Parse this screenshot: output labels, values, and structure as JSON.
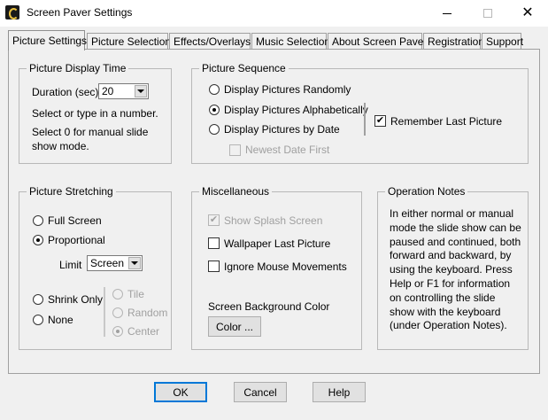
{
  "window": {
    "title": "Screen Paver Settings",
    "icons": {
      "app": "screen-paver-app-icon",
      "minimize": "minimize-icon",
      "maximize": "maximize-icon",
      "close": "close-icon"
    }
  },
  "tabs": [
    {
      "label": "Picture Settings",
      "active": true
    },
    {
      "label": "Picture Selection"
    },
    {
      "label": "Effects/Overlays"
    },
    {
      "label": "Music Selection"
    },
    {
      "label": "About Screen Paver"
    },
    {
      "label": "Registration"
    },
    {
      "label": "Support"
    }
  ],
  "display_time": {
    "title": "Picture Display Time",
    "duration_label": "Duration (sec)",
    "duration_value": "20",
    "hint1": "Select or type in a number.",
    "hint2_line1": "Select 0 for manual slide",
    "hint2_line2": "show mode."
  },
  "sequence": {
    "title": "Picture Sequence",
    "options": [
      "Display Pictures Randomly",
      "Display Pictures Alphabetically",
      "Display Pictures by Date"
    ],
    "selected": "Display Pictures Alphabetically",
    "newest_first": "Newest Date First",
    "remember_last": "Remember Last Picture",
    "remember_last_checked": true
  },
  "stretching": {
    "title": "Picture Stretching",
    "options": [
      "Full Screen",
      "Proportional",
      "Shrink Only",
      "None"
    ],
    "selected": "Proportional",
    "limit_label": "Limit",
    "limit_value": "Screen",
    "position_options": [
      "Tile",
      "Random",
      "Center"
    ],
    "position_selected": "Center"
  },
  "misc": {
    "title": "Miscellaneous",
    "show_splash": "Show Splash Screen",
    "wallpaper_last": "Wallpaper Last Picture",
    "ignore_mouse": "Ignore Mouse Movements",
    "bg_color_label": "Screen Background Color",
    "color_button": "Color ..."
  },
  "notes": {
    "title": "Operation Notes",
    "text": "In either normal or manual mode the slide show can be paused and continued, both forward and backward, by using the keyboard.  Press Help or F1 for information on controlling the slide show with the keyboard (under Operation Notes)."
  },
  "buttons": {
    "ok": "OK",
    "cancel": "Cancel",
    "help": "Help"
  },
  "check_mark": "✔"
}
